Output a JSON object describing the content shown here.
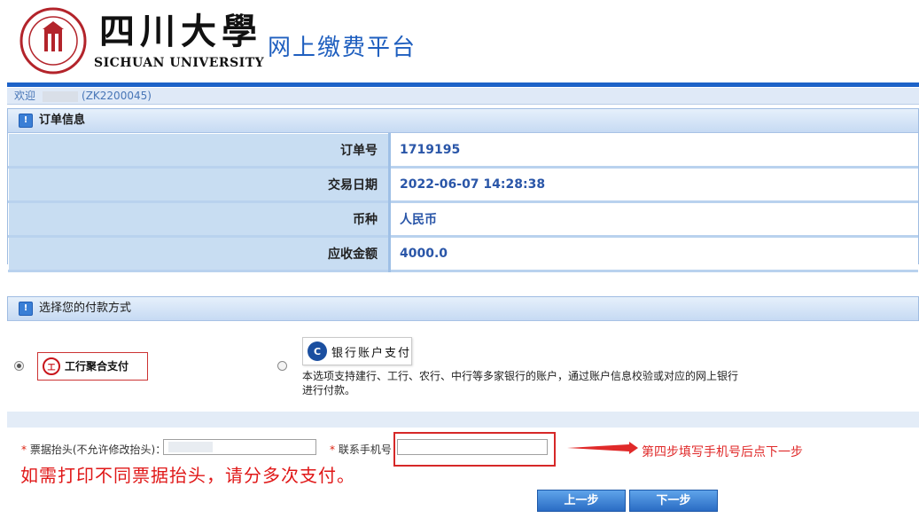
{
  "header": {
    "school_cn": "四川大學",
    "school_en": "SICHUAN UNIVERSITY",
    "platform_title": "网上缴费平台"
  },
  "welcome": {
    "prefix": "欢迎",
    "user_id": "(ZK2200045)"
  },
  "order_section": {
    "title": "订单信息",
    "rows": [
      {
        "label": "订单号",
        "value": "1719195"
      },
      {
        "label": "交易日期",
        "value": "2022-06-07 14:28:38"
      },
      {
        "label": "币种",
        "value": "人民币"
      },
      {
        "label": "应收金额",
        "value": "4000.0"
      }
    ]
  },
  "payment_section": {
    "title": "选择您的付款方式",
    "option_icbc": {
      "label": "工行聚合支付",
      "selected": true
    },
    "option_bank": {
      "label": "银行账户支付",
      "selected": false,
      "description": "本选项支持建行、工行、农行、中行等多家银行的账户，通过账户信息校验或对应的网上银行进行付款。"
    }
  },
  "form": {
    "invoice_label": "票据抬头(不允许修改抬头)：",
    "phone_label": "联系手机号：",
    "phone_value": "",
    "step_hint": "第四步填写手机号后点下一步",
    "note": "如需打印不同票据抬头，请分多次支付。"
  },
  "buttons": {
    "prev": "上一步",
    "next": "下一步"
  },
  "colors": {
    "brand_blue": "#1d62c8",
    "annotation_red": "#e01818"
  }
}
